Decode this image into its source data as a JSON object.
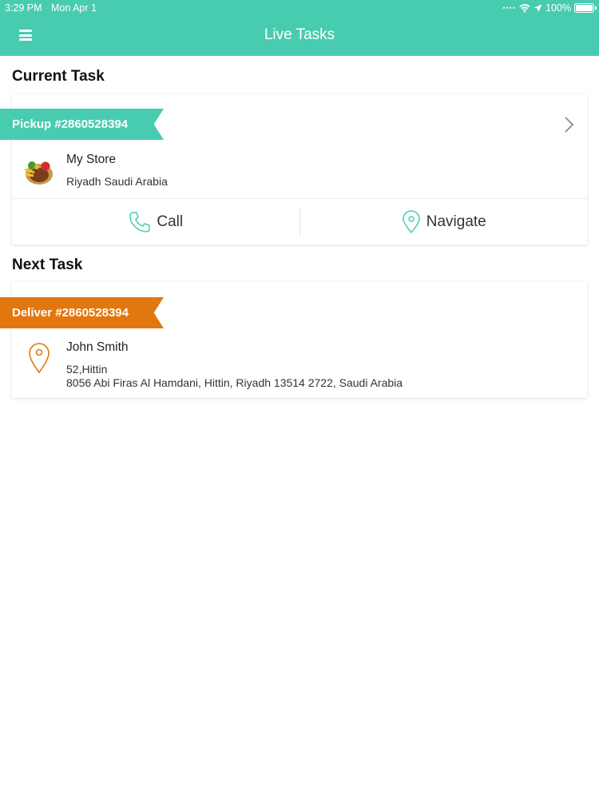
{
  "status_bar": {
    "time": "3:29 PM",
    "date": "Mon Apr 1",
    "battery": "100%",
    "battery_level": 1.0,
    "icons": [
      "signal-dots-icon",
      "wifi-icon",
      "location-arrow-icon",
      "battery-icon"
    ]
  },
  "header": {
    "title": "Live Tasks",
    "menu_icon": "hamburger-menu-icon"
  },
  "current_task": {
    "section_title": "Current Task",
    "ribbon_label": "Pickup #2860528394",
    "name": "My Store",
    "address": "Riyadh Saudi Arabia",
    "call_label": "Call",
    "navigate_label": "Navigate",
    "icons": [
      "chevron-right-icon",
      "store-food-icon",
      "phone-icon",
      "map-pin-icon"
    ]
  },
  "next_task": {
    "section_title": "Next Task",
    "ribbon_label": "Deliver #2860528394",
    "name": "John Smith",
    "address_line1": "52,Hittin",
    "address_line2": "8056 Abi Firas Al Hamdani,  Hittin,  Riyadh 13514 2722,  Saudi Arabia",
    "icons": [
      "map-pin-icon"
    ]
  },
  "colors": {
    "primary": "#48ccb0",
    "deliver": "#e3770f",
    "background": "#ffffff"
  }
}
